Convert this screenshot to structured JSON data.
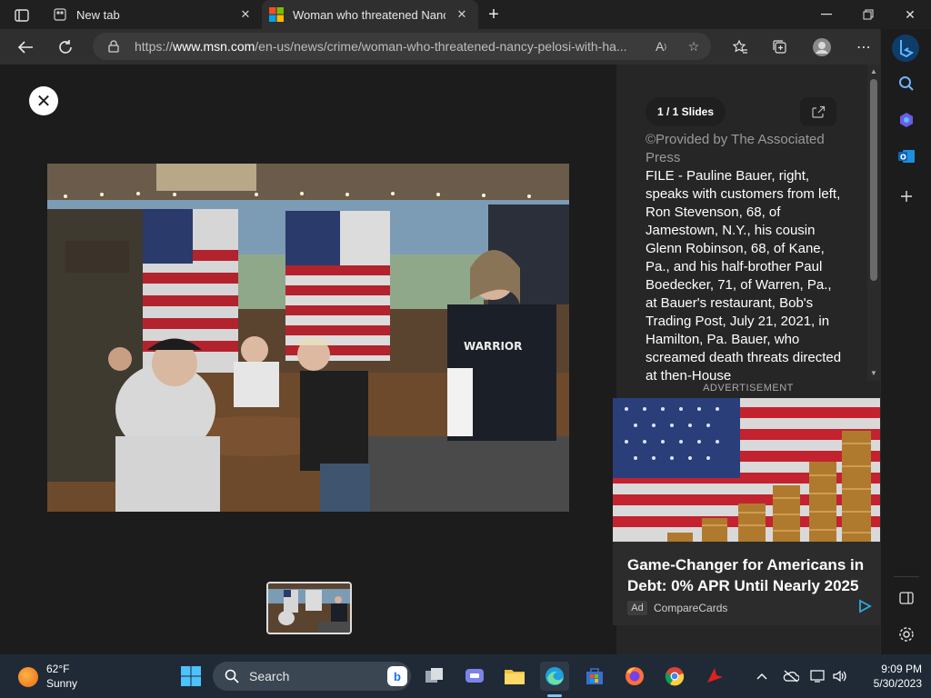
{
  "browser": {
    "tabs": [
      {
        "title": "New tab",
        "icon": "new-tab-page-icon"
      },
      {
        "title": "Woman who threatened Nancy P",
        "icon": "msn-icon"
      }
    ],
    "address": {
      "prefix": "https://",
      "domain": "www.msn.com",
      "path": "/en-us/news/crime/woman-who-threatened-nancy-pelosi-with-ha..."
    }
  },
  "viewer": {
    "slide_counter": "1 / 1 Slides",
    "credit": "©Provided by The Associated Press",
    "caption": "FILE - Pauline Bauer, right, speaks with customers from left, Ron Stevenson, 68, of Jamestown, N.Y., his cousin Glenn Robinson, 68, of Kane, Pa., and his half-brother Paul Boedecker, 71, of Warren, Pa., at Bauer's restaurant, Bob's Trading Post, July 21, 2021, in Hamilton, Pa. Bauer, who screamed death threats directed at then-House"
  },
  "ad": {
    "label": "ADVERTISEMENT",
    "headline": "Game-Changer for Americans in Debt: 0% APR Until Nearly 2025",
    "badge": "Ad",
    "source": "CompareCards"
  },
  "taskbar": {
    "weather_temp": "62°F",
    "weather_cond": "Sunny",
    "search_label": "Search",
    "time": "9:09 PM",
    "date": "5/30/2023"
  },
  "colors": {
    "accent": "#0078d4",
    "taskbar": "#1f2a36",
    "panel": "#262626"
  }
}
